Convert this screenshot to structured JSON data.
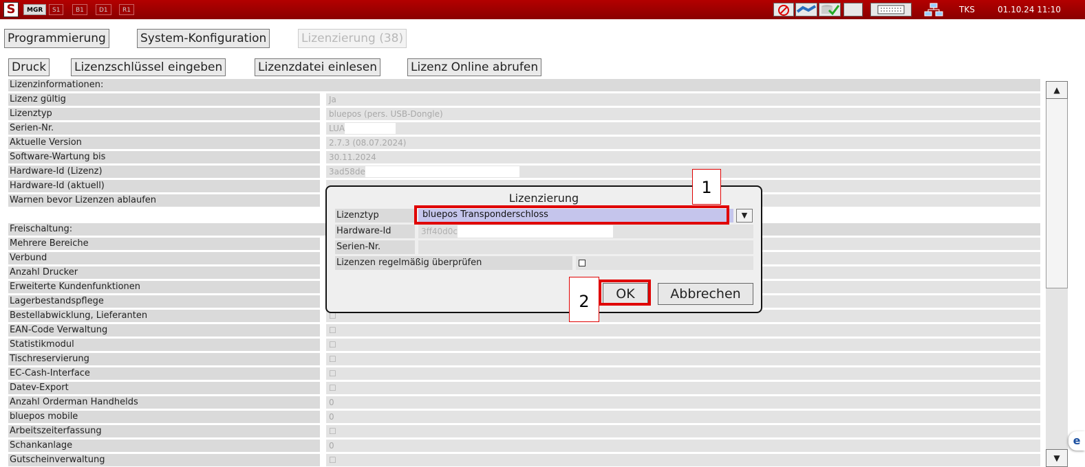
{
  "topbar": {
    "modes": [
      "MGR",
      "S1",
      "B1",
      "D1",
      "R1"
    ],
    "icons": [
      "no-printer-icon",
      "network-cable-icon",
      "database-check-icon",
      "message-icon",
      "keyboard-icon",
      "network-icon"
    ],
    "user": "TKS",
    "datetime": "01.10.24 11:10"
  },
  "tabs": [
    {
      "label": "Programmierung"
    },
    {
      "label": "System-Konfiguration"
    },
    {
      "label": "Lizenzierung (38)"
    }
  ],
  "toolbar": {
    "print": "Druck",
    "enter_key": "Lizenzschlüssel eingeben",
    "read_file": "Lizenzdatei einlesen",
    "fetch_online": "Lizenz Online abrufen"
  },
  "license_info": {
    "header": "Lizenzinformationen:",
    "rows": [
      {
        "label": "Lizenz gültig",
        "value": "Ja"
      },
      {
        "label": "Lizenztyp",
        "value": "bluepos (pers. USB-Dongle)"
      },
      {
        "label": "Serien-Nr.",
        "value": "LUA"
      },
      {
        "label": "Aktuelle Version",
        "value": "2.7.3 (08.07.2024)"
      },
      {
        "label": "Software-Wartung bis",
        "value": "30.11.2024"
      },
      {
        "label": "Hardware-Id (Lizenz)",
        "value": "3ad58de"
      },
      {
        "label": "Hardware-Id (aktuell)",
        "value": ""
      },
      {
        "label": "Warnen bevor Lizenzen ablaufen",
        "value": ""
      }
    ]
  },
  "activation": {
    "header": "Freischaltung:",
    "rows": [
      {
        "label": "Mehrere Bereiche",
        "value": ""
      },
      {
        "label": "Verbund",
        "value": ""
      },
      {
        "label": "Anzahl Drucker",
        "value": ""
      },
      {
        "label": "Erweiterte Kundenfunktionen",
        "value": ""
      },
      {
        "label": "Lagerbestandspflege",
        "value": ""
      },
      {
        "label": "Bestellabwicklung, Lieferanten",
        "value": "☐"
      },
      {
        "label": "EAN-Code Verwaltung",
        "value": "☐"
      },
      {
        "label": "Statistikmodul",
        "value": "☐"
      },
      {
        "label": "Tischreservierung",
        "value": "☐"
      },
      {
        "label": "EC-Cash-Interface",
        "value": "☐"
      },
      {
        "label": "Datev-Export",
        "value": "☐"
      },
      {
        "label": "Anzahl Orderman Handhelds",
        "value": "0"
      },
      {
        "label": "bluepos mobile",
        "value": "0"
      },
      {
        "label": "Arbeitszeiterfassung",
        "value": "☐"
      },
      {
        "label": "Schankanlage",
        "value": "0"
      },
      {
        "label": "Gutscheinverwaltung",
        "value": "☐"
      }
    ]
  },
  "dialog": {
    "title": "Lizenzierung",
    "type_label": "Lizenztyp",
    "type_value": "bluepos Transponderschloss",
    "hwid_label": "Hardware-Id",
    "hwid_value": "3ff40d0c",
    "serial_label": "Serien-Nr.",
    "serial_value": "",
    "check_label": "Lizenzen regelmäßig überprüfen",
    "ok": "OK",
    "cancel": "Abbrechen"
  },
  "callouts": {
    "step1": "1",
    "step2": "2"
  },
  "colors": {
    "topbar": "#a00000",
    "highlight": "#e00000",
    "selection": "#c5c5ec"
  }
}
